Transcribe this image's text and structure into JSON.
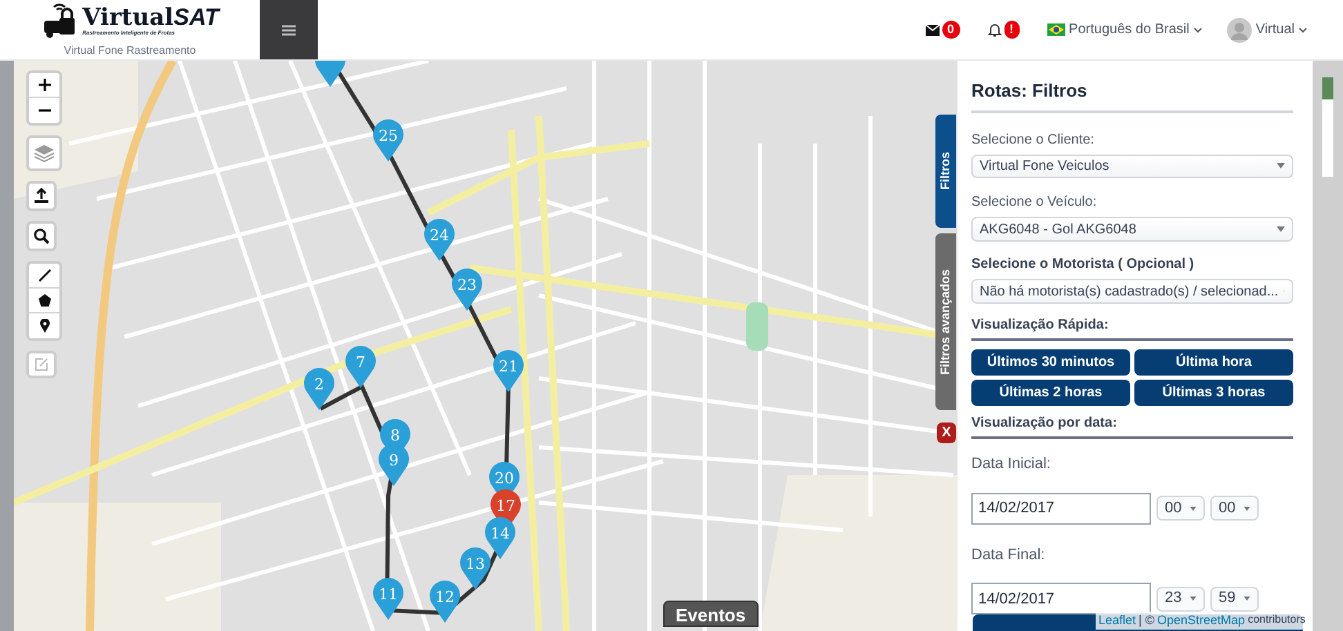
{
  "header": {
    "logo": {
      "word": "Virtual",
      "accent": "SAT",
      "tagline": "Rastreamento Inteligente de Frotas"
    },
    "subtitle": "Virtual Fone Rastreamento",
    "messages_badge": "0",
    "alerts_badge": "!",
    "language": "Português do Brasil",
    "user": "Virtual"
  },
  "map": {
    "markers": [
      {
        "color": "#2a9fd8"
      },
      {
        "label": "25",
        "color": "#2a9fd8"
      },
      {
        "label": "24",
        "color": "#2a9fd8"
      },
      {
        "label": "23",
        "color": "#2a9fd8"
      },
      {
        "label": "21",
        "color": "#2a9fd8"
      },
      {
        "label": "7",
        "color": "#2a9fd8"
      },
      {
        "label": "2",
        "color": "#2a9fd8"
      },
      {
        "label": "8",
        "color": "#2a9fd8"
      },
      {
        "label": "9",
        "color": "#2a9fd8"
      },
      {
        "label": "20",
        "color": "#2a9fd8"
      },
      {
        "label": "17",
        "color": "#d9412b"
      },
      {
        "label": "14",
        "color": "#2a9fd8"
      },
      {
        "label": "13",
        "color": "#2a9fd8"
      },
      {
        "label": "12",
        "color": "#2a9fd8"
      },
      {
        "label": "11",
        "color": "#2a9fd8"
      }
    ],
    "events_button": "Eventos",
    "attribution": {
      "leaflet": "Leaflet",
      "separator": "| ©",
      "osm": "OpenStreetMap",
      "suffix": "contributors"
    }
  },
  "side_tabs": [
    {
      "label": "Filtros",
      "selected": true
    },
    {
      "label": "Filtros avançados",
      "selected": false
    }
  ],
  "close_button": "X",
  "panel": {
    "title": "Rotas: Filtros",
    "client": {
      "label": "Selecione o Cliente:",
      "value": "Virtual Fone Veiculos"
    },
    "vehicle": {
      "label": "Selecione o Veículo:",
      "value": "AKG6048 - Gol AKG6048"
    },
    "driver": {
      "label": "Selecione o Motorista ( Opcional )",
      "value": "Não há motorista(s) cadastrado(s) / selecionad..."
    },
    "quick_view": {
      "heading": "Visualização Rápida:",
      "buttons": [
        "Últimos 30 minutos",
        "Última hora",
        "Últimas 2 horas",
        "Últimas 3 horas"
      ]
    },
    "date_view": {
      "heading": "Visualização por data:",
      "start": {
        "label": "Data Inicial:",
        "date": "14/02/2017",
        "hour": "00",
        "minute": "00"
      },
      "end": {
        "label": "Data Final:",
        "date": "14/02/2017",
        "hour": "23",
        "minute": "59"
      }
    }
  }
}
